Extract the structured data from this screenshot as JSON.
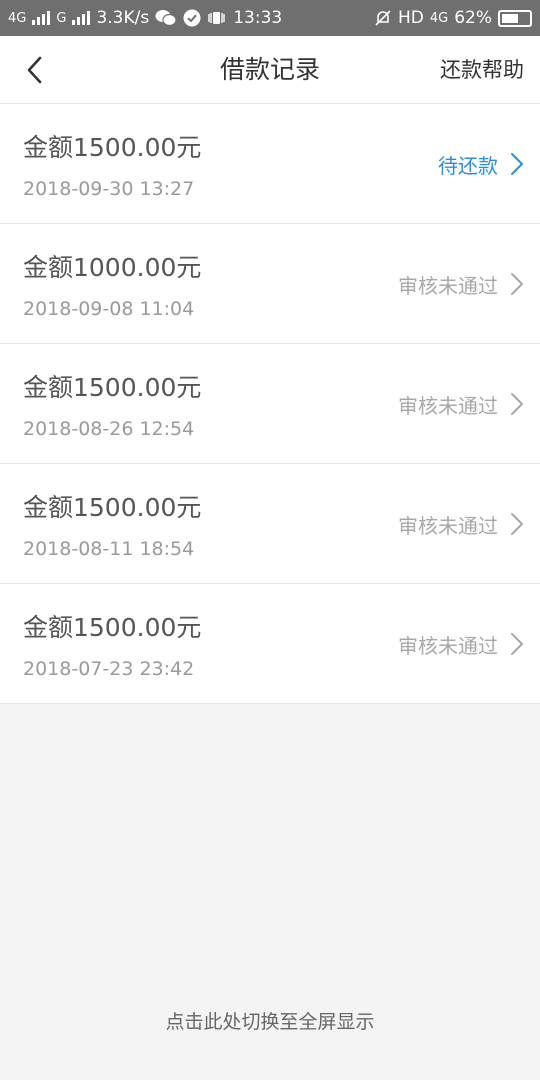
{
  "status_bar": {
    "net1": "4G",
    "net2": "G",
    "speed": "3.3K/s",
    "time": "13:33",
    "hd": "HD",
    "net3": "4G",
    "battery": "62%",
    "battery_level": 0.62
  },
  "header": {
    "title": "借款记录",
    "help": "还款帮助"
  },
  "records": [
    {
      "amount": "金额1500.00元",
      "date": "2018-09-30 13:27",
      "status": "待还款",
      "color": "#2e8fd6"
    },
    {
      "amount": "金额1000.00元",
      "date": "2018-09-08 11:04",
      "status": "审核未通过",
      "color": "#a8a8a8"
    },
    {
      "amount": "金额1500.00元",
      "date": "2018-08-26 12:54",
      "status": "审核未通过",
      "color": "#a8a8a8"
    },
    {
      "amount": "金额1500.00元",
      "date": "2018-08-11 18:54",
      "status": "审核未通过",
      "color": "#a8a8a8"
    },
    {
      "amount": "金额1500.00元",
      "date": "2018-07-23 23:42",
      "status": "审核未通过",
      "color": "#a8a8a8"
    }
  ],
  "footer": {
    "fullscreen": "点击此处切换至全屏显示"
  }
}
